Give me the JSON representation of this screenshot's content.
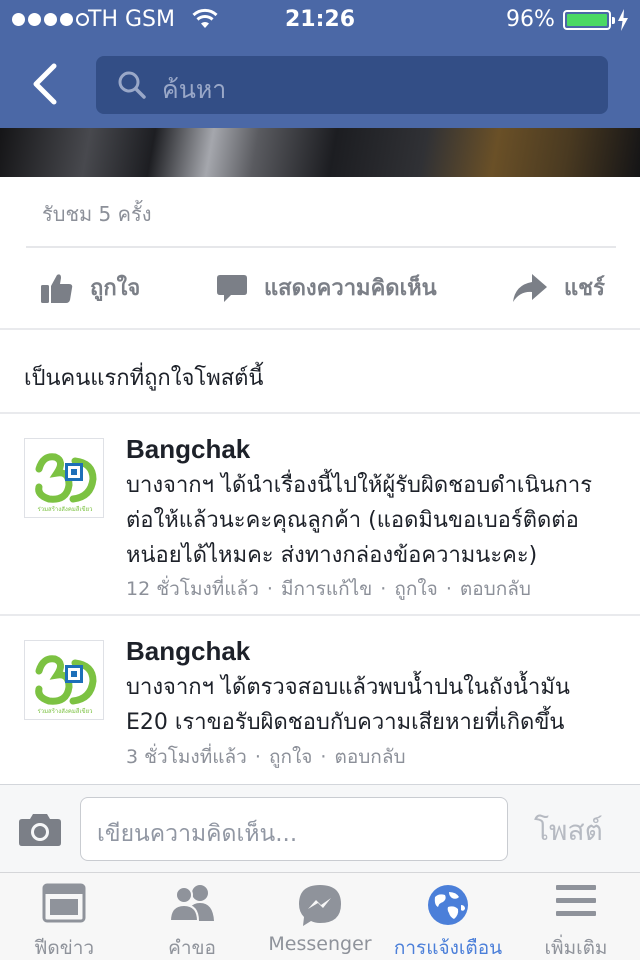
{
  "status_bar": {
    "carrier": "TH GSM",
    "time": "21:26",
    "battery": "96%"
  },
  "nav": {
    "search_placeholder": "ค้นหา"
  },
  "post": {
    "views": "รับชม 5 ครั้ง",
    "actions": {
      "like": "ถูกใจ",
      "comment": "แสดงความคิดเห็น",
      "share": "แชร์"
    },
    "first_like_prompt": "เป็นคนแรกที่ถูกใจโพสต์นี้"
  },
  "comments": [
    {
      "author": "Bangchak",
      "lines": [
        "บางจากฯ ได้นำเรื่องนี้ไปให้ผู้รับผิดชอบดำเนินการ",
        "ต่อให้แล้วนะคะคุณลูกค้า (แอดมินขอเบอร์ติดต่อ",
        "หน่อยได้ไหมคะ ส่งทางกล่องข้อความนะคะ)"
      ],
      "time": "12 ชั่วโมงที่แล้ว",
      "edited": "มีการแก้ไข",
      "like": "ถูกใจ",
      "reply": "ตอบกลับ"
    },
    {
      "author": "Bangchak",
      "lines": [
        "บางจากฯ ได้ตรวจสอบแล้วพบน้ำปนในถังน้ำมัน",
        "E20  เราขอรับผิดชอบกับความเสียหายที่เกิดขึ้น"
      ],
      "time": "3 ชั่วโมงที่แล้ว",
      "like": "ถูกใจ",
      "reply": "ตอบกลับ"
    }
  ],
  "composer": {
    "placeholder": "เขียนความคิดเห็น...",
    "post_label": "โพสต์"
  },
  "tabbar": {
    "items": [
      {
        "label": "ฟีดข่าว",
        "icon": "news-feed-icon"
      },
      {
        "label": "คำขอ",
        "icon": "friend-requests-icon"
      },
      {
        "label": "Messenger",
        "icon": "messenger-icon"
      },
      {
        "label": "การแจ้งเตือน",
        "icon": "notifications-globe-icon",
        "active": true
      },
      {
        "label": "เพิ่มเติม",
        "icon": "more-menu-icon"
      }
    ]
  },
  "colors": {
    "nav_bar": "#4b68a6",
    "active_tab": "#4b7fd9",
    "battery": "#4cd964",
    "brand_green": "#7cc242"
  }
}
